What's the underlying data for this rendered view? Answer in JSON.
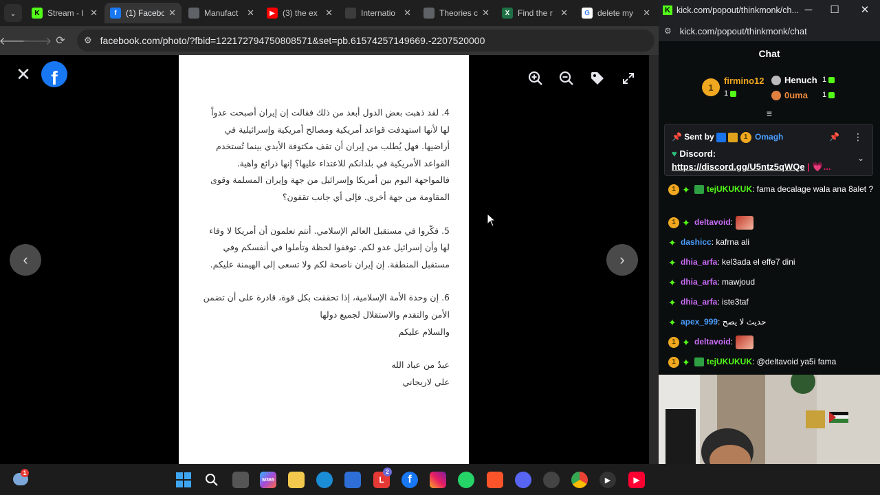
{
  "browser": {
    "tabs": [
      {
        "title": "Stream - I",
        "fav": "K",
        "fav_color": "#53fc18",
        "icon": "kick-icon"
      },
      {
        "title": "(1) Facebo",
        "fav": "f",
        "fav_color": "#1877f2",
        "icon": "facebook-icon"
      },
      {
        "title": "Manufact",
        "fav": "",
        "fav_color": "#5f6368",
        "icon": "globe-icon"
      },
      {
        "title": "(3) the ex",
        "fav": "▶",
        "fav_color": "#ff0000",
        "icon": "youtube-icon"
      },
      {
        "title": "Internatio",
        "fav": "",
        "fav_color": "#3c3c3c",
        "icon": "document-icon"
      },
      {
        "title": "Theories c",
        "fav": "",
        "fav_color": "#5f6368",
        "icon": "globe-icon"
      },
      {
        "title": "Find the r",
        "fav": "X",
        "fav_color": "#1e7145",
        "icon": "excel-icon"
      },
      {
        "title": "delete my",
        "fav": "G",
        "fav_color": "#ffffff",
        "icon": "google-icon"
      }
    ],
    "url": "facebook.com/photo/?fbid=122172794750808571&set=pb.61574257149669.-2207520000"
  },
  "photo": {
    "paragraphs": [
      "4. لقد ذهبت بعض الدول أبعد من ذلك فقالت إن إيران أصبحت عدواً لها لأنها استهدفت قواعد أمريكية ومصالح أمريكية وإسرائيلية في أراضيها. فهل يُطلب من إيران أن تقف مكتوفة الأيدي بينما تُستخدم القواعد الأمريكية في بلدانكم للاعتداء عليها؟ إنها ذرائع واهية. فالمواجهة اليوم بين أمريكا وإسرائيل من جهة وإيران المسلمة وقوى المقاومة من جهة أخرى. فإلى أي جانب تقفون؟",
      "5. فكّروا في مستقبل العالم الإسلامي. أنتم تعلمون أن أمريكا لا وفاء لها وأن إسرائيل عدو لكم. توقفوا لحظة وتأملوا في أنفسكم وفي مستقبل المنطقة. إن إيران ناصحة لكم ولا تسعى إلى الهيمنة عليكم.",
      "6. إن وحدة الأمة الإسلامية، إذا تحققت بكل قوة، قادرة على أن تضمن الأمن والتقدم والاستقلال لجميع دولها"
    ],
    "closing": "والسلام عليكم",
    "sig_line1": "عبدٌ من عباد الله",
    "sig_line2": "علي لاريجاني"
  },
  "kick": {
    "window_title": "kick.com/popout/thinkmonk/ch...",
    "url": "kick.com/popout/thinkmonk/chat",
    "chat_title": "Chat",
    "leaderboard": [
      {
        "name": "firmino12",
        "count": "1",
        "color": "#f0a820",
        "rank": "1"
      },
      {
        "name": "Henuch",
        "count": "1",
        "color": "#ffffff",
        "rank": "2"
      },
      {
        "name": "0uma",
        "count": "1",
        "color": "#f08a3c",
        "rank": "3"
      }
    ],
    "pinned": {
      "sent_by_label": "Sent by",
      "sender": "Omagh",
      "title": "Discord:",
      "link": "https://discord.gg/U5ntz5qWQe",
      "suffix": "| 💗..."
    },
    "messages": [
      {
        "user": "tejUKUKUK",
        "color": "#53fc18",
        "text": ": fama decalage wala ana 8alet ?",
        "badges": [
          "sub",
          "og",
          "gift"
        ]
      },
      {
        "user": "deltavoid",
        "color": "#c86cf5",
        "text": ":",
        "badges": [
          "sub",
          "og"
        ],
        "emote": true
      },
      {
        "user": "dashicc",
        "color": "#4a9eff",
        "text": ": kafrna ali",
        "badges": [
          "og"
        ]
      },
      {
        "user": "dhia_arfa",
        "color": "#c86cf5",
        "text": ": kel3ada el effe7 dini",
        "badges": [
          "og"
        ]
      },
      {
        "user": "dhia_arfa",
        "color": "#c86cf5",
        "text": ": mawjoud",
        "badges": [
          "og"
        ]
      },
      {
        "user": "dhia_arfa",
        "color": "#c86cf5",
        "text": ": iste3taf",
        "badges": [
          "og"
        ]
      },
      {
        "user": "apex_999",
        "color": "#4a9eff",
        "text": ": حديث لا يصح",
        "badges": [
          "og"
        ]
      },
      {
        "user": "deltavoid",
        "color": "#c86cf5",
        "text": ":",
        "badges": [
          "sub",
          "og"
        ],
        "emote": true
      },
      {
        "user": "tejUKUKUK",
        "color": "#53fc18",
        "text": ": @deltavoid ya5i fama",
        "badges": [
          "sub",
          "og",
          "gift"
        ]
      }
    ]
  },
  "taskbar": {
    "notification_badge_1": "1",
    "notification_badge_2": "2",
    "app_label_m365": "M365"
  }
}
